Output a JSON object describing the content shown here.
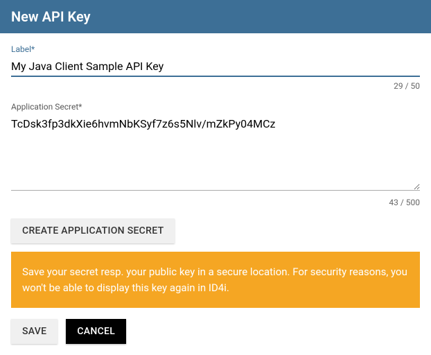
{
  "header": {
    "title": "New API Key"
  },
  "form": {
    "label_field": {
      "label": "Label*",
      "value": "My Java Client Sample API Key",
      "counter": "29 / 50"
    },
    "secret_field": {
      "label": "Application Secret*",
      "value": "TcDsk3fp3dkXie6hvmNbKSyf7z6s5Nlv/mZkPy04MCz",
      "counter": "43 / 500"
    }
  },
  "buttons": {
    "create_secret": "CREATE APPLICATION SECRET",
    "save": "SAVE",
    "cancel": "CANCEL"
  },
  "alert": {
    "text": "Save your secret resp. your public key in a secure location. For security reasons, you won't be able to display this key again in ID4i."
  }
}
